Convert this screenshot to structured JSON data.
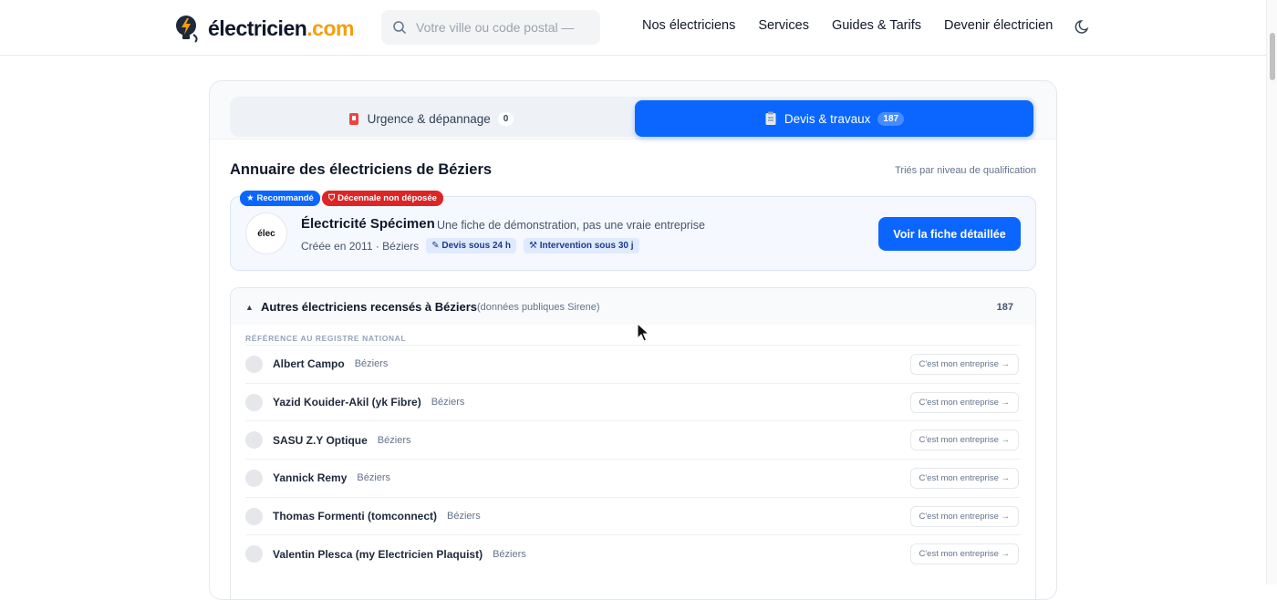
{
  "header": {
    "logo_main": "électricien",
    "logo_tld": ".com",
    "search_placeholder": "Votre ville ou code postal —",
    "nav": [
      "Nos électriciens",
      "Services",
      "Guides & Tarifs",
      "Devenir électricien"
    ],
    "theme_icon": "moon-icon"
  },
  "tabs": {
    "urgence": {
      "label": "Urgence & dépannage",
      "count": "0"
    },
    "devis": {
      "label": "Devis & travaux",
      "count": "187"
    }
  },
  "section": {
    "title": "Annuaire des électriciens de Béziers",
    "sort_note": "Triés par niveau de qualification"
  },
  "featured": {
    "badge_recommended": "Recommandé",
    "badge_decennale": "Décennale non déposée",
    "logo_text": "élec",
    "name": "Électricité Spécimen",
    "description": "Une fiche de démonstration, pas une vraie entreprise",
    "meta": "Créée en 2011 · Béziers",
    "chip_devis": "Devis sous 24 h",
    "chip_intervention": "Intervention sous 30 j",
    "button": "Voir la fiche détaillée"
  },
  "others": {
    "title": "Autres électriciens recensés à Béziers",
    "subtitle": "(données publiques Sirene)",
    "count": "187",
    "registry_label": "RÉFÉRENCE AU REGISTRE NATIONAL",
    "cta": "C'est mon entreprise →",
    "rows": [
      {
        "name": "Albert Campo",
        "city": "Béziers"
      },
      {
        "name": "Yazid Kouider-Akil (yk Fibre)",
        "city": "Béziers"
      },
      {
        "name": "SASU Z.Y Optique",
        "city": "Béziers"
      },
      {
        "name": "Yannick Remy",
        "city": "Béziers"
      },
      {
        "name": "Thomas Formenti (tomconnect)",
        "city": "Béziers"
      },
      {
        "name": "Valentin Plesca (my Electricien Plaquist)",
        "city": "Béziers"
      }
    ]
  },
  "colors": {
    "primary": "#0a66ff",
    "danger": "#dc2626",
    "accent": "#f59e0b"
  }
}
